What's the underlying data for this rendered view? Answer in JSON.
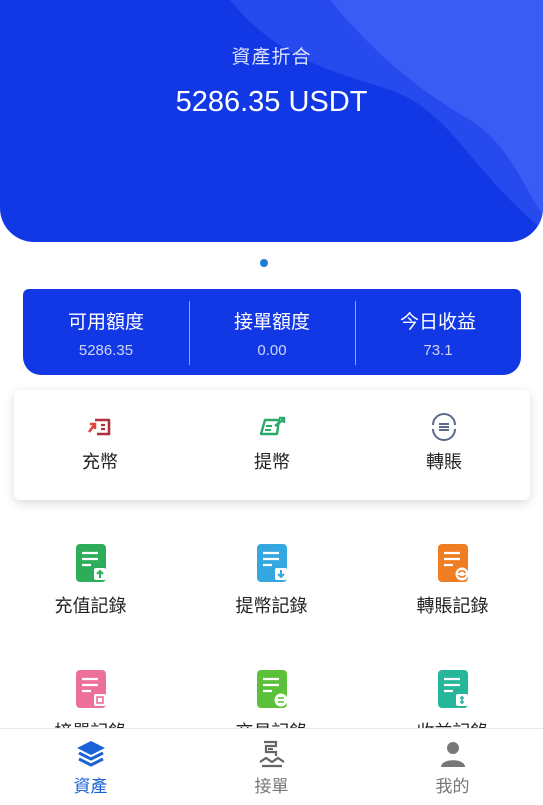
{
  "hero": {
    "label": "資產折合",
    "value": "5286.35 USDT"
  },
  "stats": [
    {
      "title": "可用額度",
      "value": "5286.35"
    },
    {
      "title": "接單額度",
      "value": "0.00"
    },
    {
      "title": "今日收益",
      "value": "73.1"
    }
  ],
  "actions": [
    {
      "label": "充幣",
      "icon": "deposit-icon",
      "color": "#b0303d"
    },
    {
      "label": "提幣",
      "icon": "withdraw-icon",
      "color": "#2aaa6a"
    },
    {
      "label": "轉賬",
      "icon": "transfer-icon",
      "color": "#5a6a8a"
    }
  ],
  "records": [
    {
      "label": "充值記錄",
      "icon": "deposit-record-icon",
      "color": "#2dac5a"
    },
    {
      "label": "提幣記錄",
      "icon": "withdraw-record-icon",
      "color": "#34a7e0"
    },
    {
      "label": "轉賬記錄",
      "icon": "transfer-record-icon",
      "color": "#ef7d22"
    },
    {
      "label": "接單記錄",
      "icon": "order-record-icon",
      "color": "#ec7098"
    },
    {
      "label": "交易記錄",
      "icon": "trade-record-icon",
      "color": "#5cc13a"
    },
    {
      "label": "收益記錄",
      "icon": "income-record-icon",
      "color": "#26b79a"
    }
  ],
  "tabs": [
    {
      "label": "資產",
      "icon": "layers-icon",
      "active": true
    },
    {
      "label": "接單",
      "icon": "order-icon",
      "active": false
    },
    {
      "label": "我的",
      "icon": "user-icon",
      "active": false
    }
  ],
  "colors": {
    "brand_blue": "#1238e6",
    "active_tab": "#1a62d6"
  }
}
